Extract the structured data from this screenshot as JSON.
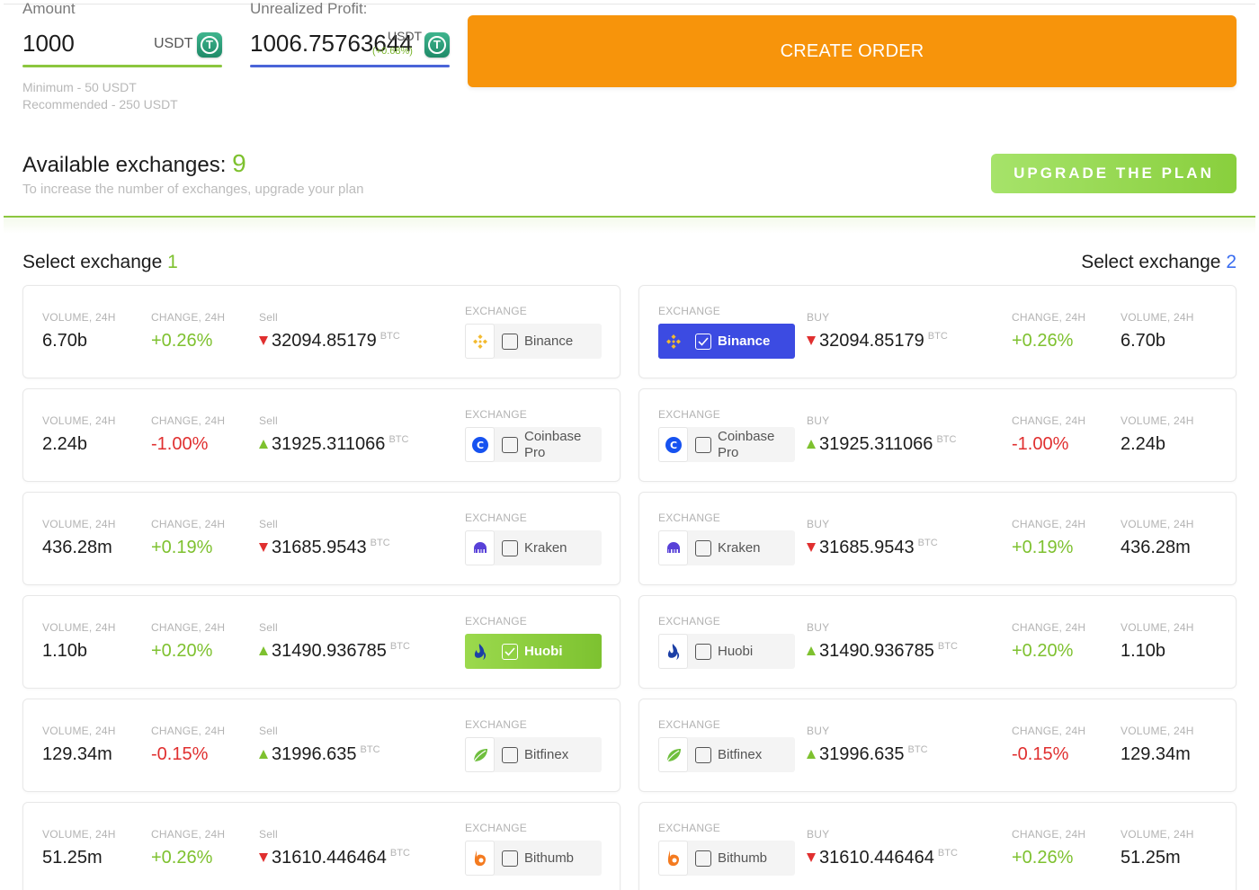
{
  "order": {
    "amount_label": "Amount",
    "amount_value": "1000",
    "amount_unit": "USDT",
    "profit_label": "Unrealized Profit:",
    "profit_value": "1006.75763644",
    "profit_unit": "USDT",
    "profit_change": "(+0.68%)",
    "min_hint": "Minimum - 50 USDT",
    "rec_hint": "Recommended - 250 USDT",
    "create_label": "CREATE ORDER"
  },
  "available": {
    "title": "Available exchanges:",
    "count": "9",
    "hint": "To increase the number of exchanges, upgrade your plan",
    "upgrade_label": "UPGRADE THE PLAN"
  },
  "select1": {
    "title": "Select exchange",
    "num": "1"
  },
  "select2": {
    "title": "Select exchange",
    "num": "2"
  },
  "labels": {
    "volume": "VOLUME, 24H",
    "change": "CHANGE, 24H",
    "sell": "Sell",
    "buy": "BUY",
    "exchange": "EXCHANGE",
    "btc": "BTC"
  },
  "colors": {
    "accent_orange": "#f7940b",
    "accent_green": "#7ec12f",
    "accent_blue": "#3c4be2",
    "negative": "#e02f2f"
  },
  "exchanges": [
    {
      "name": "Binance",
      "volume": "6.70b",
      "change": "+0.26%",
      "price": "32094.85179",
      "direction": "down",
      "logo": "binance-icon"
    },
    {
      "name": "Coinbase Pro",
      "volume": "2.24b",
      "change": "-1.00%",
      "price": "31925.311066",
      "direction": "up",
      "logo": "coinbase-icon"
    },
    {
      "name": "Kraken",
      "volume": "436.28m",
      "change": "+0.19%",
      "price": "31685.9543",
      "direction": "down",
      "logo": "kraken-icon"
    },
    {
      "name": "Huobi",
      "volume": "1.10b",
      "change": "+0.20%",
      "price": "31490.936785",
      "direction": "up",
      "logo": "huobi-icon"
    },
    {
      "name": "Bitfinex",
      "volume": "129.34m",
      "change": "-0.15%",
      "price": "31996.635",
      "direction": "up",
      "logo": "bitfinex-icon"
    },
    {
      "name": "Bithumb",
      "volume": "51.25m",
      "change": "+0.26%",
      "price": "31610.446464",
      "direction": "down",
      "logo": "bithumb-icon"
    }
  ],
  "selected": {
    "left": "Huobi",
    "right": "Binance"
  }
}
